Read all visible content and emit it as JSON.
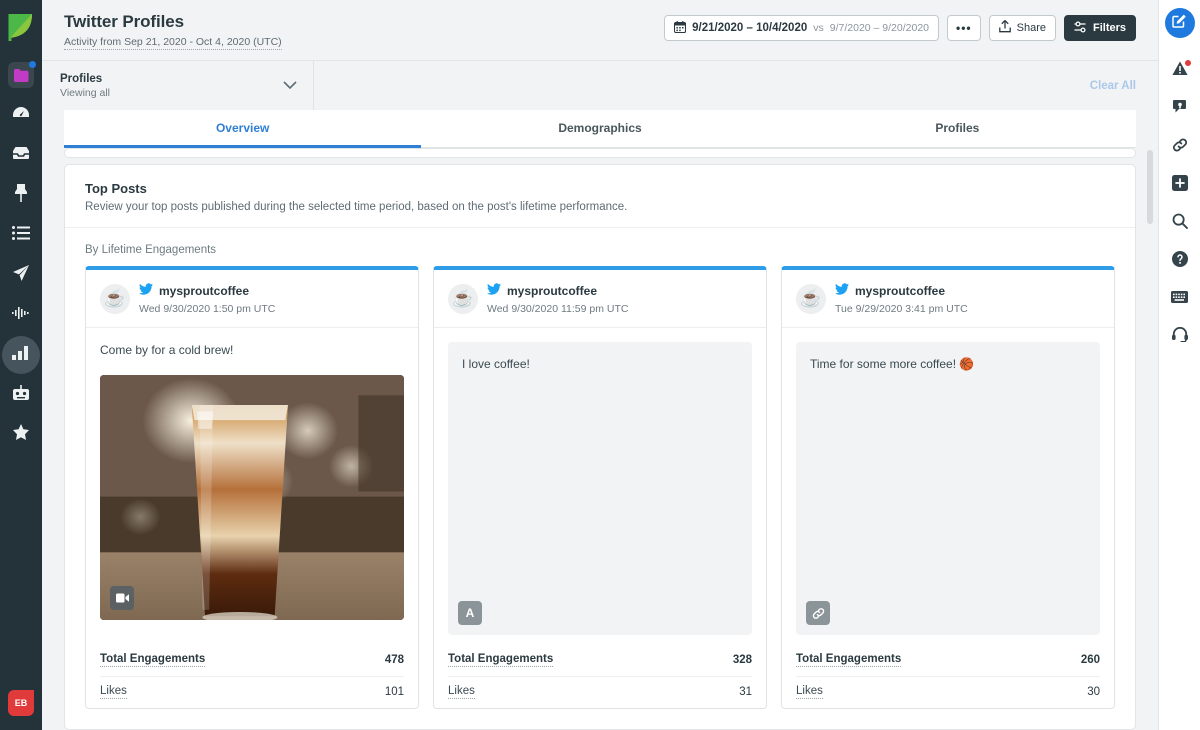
{
  "brand": {
    "accent": "#2f7fd4",
    "dark": "#243239",
    "twitter_blue": "#2f9ce8",
    "logo_icon": "sprout-leaf-icon"
  },
  "left_rail": {
    "logo_name": "sprout-logo",
    "items": [
      {
        "name": "folder-icon",
        "badge": true
      },
      {
        "name": "gauge-icon",
        "badge": false
      },
      {
        "name": "inbox-icon",
        "badge": false
      },
      {
        "name": "pin-icon",
        "badge": false
      },
      {
        "name": "list-icon",
        "badge": false
      },
      {
        "name": "send-icon",
        "badge": false
      },
      {
        "name": "waveform-icon",
        "badge": false
      },
      {
        "name": "bar-chart-icon",
        "badge": false,
        "active": true
      },
      {
        "name": "robot-icon",
        "badge": false
      },
      {
        "name": "star-badge-icon",
        "badge": false
      }
    ],
    "avatar_initials": "EB",
    "expand_icon": "expand-rail-icon"
  },
  "header": {
    "title": "Twitter Profiles",
    "subtitle": "Activity from Sep 21, 2020 - Oct 4, 2020 (UTC)",
    "date_range": "9/21/2020 – 10/4/2020",
    "compare_prefix": "vs",
    "compare_range": "9/7/2020 – 9/20/2020",
    "calendar_icon": "calendar-icon",
    "more_label": "•••",
    "share_label": "Share",
    "share_icon": "share-icon",
    "filters_label": "Filters",
    "filters_icon": "sliders-icon"
  },
  "filter_bar": {
    "profiles_label": "Profiles",
    "profiles_value": "Viewing all",
    "chevron_icon": "chevron-down-icon",
    "clear_all_label": "Clear All"
  },
  "tabs": [
    {
      "label": "Overview",
      "active": true
    },
    {
      "label": "Demographics",
      "active": false
    },
    {
      "label": "Profiles",
      "active": false
    }
  ],
  "top_posts": {
    "title": "Top Posts",
    "description": "Review your top posts published during the selected time period, based on the post's lifetime performance.",
    "sort_label": "By Lifetime Engagements",
    "posts": [
      {
        "network_icon": "twitter-icon",
        "avatar_icon": "coffee-cup-icon",
        "handle": "mysproutcoffee",
        "date": "Wed 9/30/2020 1:50 pm UTC",
        "text": "Come by for a cold brew!",
        "media_type": "image",
        "media_badge_icon": "video-camera-icon",
        "media_badge_text": "",
        "metrics": [
          {
            "label": "Total Engagements",
            "value": "478",
            "primary": true
          },
          {
            "label": "Likes",
            "value": "101",
            "primary": false
          }
        ]
      },
      {
        "network_icon": "twitter-icon",
        "avatar_icon": "coffee-cup-icon",
        "handle": "mysproutcoffee",
        "date": "Wed 9/30/2020 11:59 pm UTC",
        "text": "I love coffee!",
        "media_type": "none",
        "media_badge_icon": "text-badge",
        "media_badge_text": "A",
        "metrics": [
          {
            "label": "Total Engagements",
            "value": "328",
            "primary": true
          },
          {
            "label": "Likes",
            "value": "31",
            "primary": false
          }
        ]
      },
      {
        "network_icon": "twitter-icon",
        "avatar_icon": "coffee-cup-icon",
        "handle": "mysproutcoffee",
        "date": "Tue 9/29/2020 3:41 pm UTC",
        "text": "Time for some more coffee! 🏀",
        "media_type": "none",
        "media_badge_icon": "link-icon",
        "media_badge_text": "",
        "metrics": [
          {
            "label": "Total Engagements",
            "value": "260",
            "primary": true
          },
          {
            "label": "Likes",
            "value": "30",
            "primary": false
          }
        ]
      }
    ]
  },
  "right_rail": {
    "compose_icon": "compose-icon",
    "items": [
      {
        "name": "alert-triangle-icon",
        "badge": true
      },
      {
        "name": "message-tag-icon",
        "badge": false
      },
      {
        "name": "link-icon",
        "badge": false
      },
      {
        "name": "plus-square-icon",
        "badge": false
      },
      {
        "name": "search-icon",
        "badge": false
      },
      {
        "name": "help-circle-icon",
        "badge": false
      },
      {
        "name": "keyboard-icon",
        "badge": false
      },
      {
        "name": "headset-icon",
        "badge": false
      }
    ]
  }
}
